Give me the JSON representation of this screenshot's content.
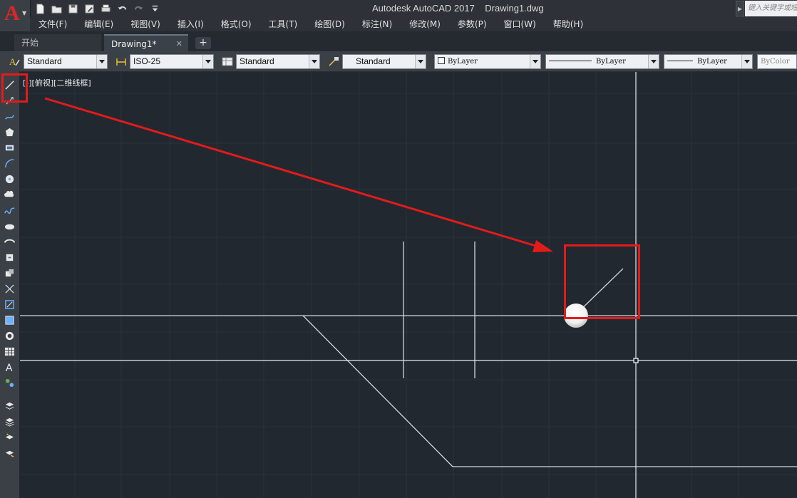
{
  "window": {
    "title": "Autodesk AutoCAD 2017    Drawing1.dwg",
    "search_placeholder": "键入关键字或短语"
  },
  "app_button": {
    "logo": "A"
  },
  "quick_access": [
    {
      "icon": "new-file-icon"
    },
    {
      "icon": "open-folder-icon"
    },
    {
      "icon": "save-icon"
    },
    {
      "icon": "save-as-icon"
    },
    {
      "icon": "print-icon"
    },
    {
      "icon": "undo-icon"
    },
    {
      "icon": "redo-icon"
    },
    {
      "icon": "customize-dropdown-icon"
    }
  ],
  "menu": [
    "文件(F)",
    "编辑(E)",
    "视图(V)",
    "插入(I)",
    "格式(O)",
    "工具(T)",
    "绘图(D)",
    "标注(N)",
    "修改(M)",
    "参数(P)",
    "窗口(W)",
    "帮助(H)"
  ],
  "tabs": [
    {
      "label": "开始",
      "active": false
    },
    {
      "label": "Drawing1*",
      "active": true,
      "close": "✕"
    }
  ],
  "tab_add": "+",
  "styles": {
    "text_style": "Standard",
    "dim_style": "ISO-25",
    "table_style": "Standard",
    "multileader_style": "Standard",
    "layer_color": "ByLayer",
    "linetype": "ByLayer",
    "lineweight": "ByLayer",
    "plot_color": "ByColor"
  },
  "viewport_label": "[-][俯视][二维线框]",
  "left_tools": [
    "line-icon",
    "ray-icon",
    "polyline-icon",
    "polygon-icon",
    "rectangle-icon",
    "arc-icon",
    "circle-icon",
    "revision-cloud-icon",
    "spline-icon",
    "ellipse-icon",
    "ellipse-arc-icon",
    "insert-block-icon",
    "make-block-icon",
    "construction-line-icon",
    "hatch-icon",
    "gradient-icon",
    "region-icon",
    "table-icon",
    "mtext-icon",
    "add-selected-icon",
    "layer-icon-1",
    "layer-icon-2",
    "layer-icon-3",
    "layer-icon-4"
  ],
  "colors": {
    "background": "#212830",
    "grid": "#2b333d",
    "geometry": "#d6d6d6",
    "annotation": "#e21b1b"
  }
}
